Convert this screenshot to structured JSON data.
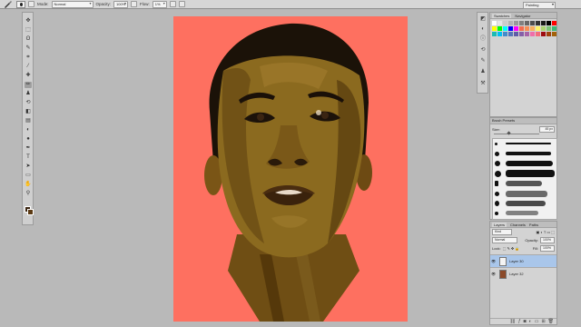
{
  "options_bar": {
    "mode_label": "Mode:",
    "mode_value": "Normal",
    "opacity_label": "Opacity:",
    "opacity_value": "100%",
    "flow_label": "Flow:",
    "flow_value": "1%"
  },
  "workspace": "Painting",
  "toolbar": {
    "tools": [
      {
        "name": "move-icon",
        "glyph": "✥"
      },
      {
        "name": "marquee-icon",
        "glyph": "⬚"
      },
      {
        "name": "lasso-icon",
        "glyph": "ʘ"
      },
      {
        "name": "quick-select-icon",
        "glyph": "✎"
      },
      {
        "name": "crop-icon",
        "glyph": "⌗"
      },
      {
        "name": "eyedropper-icon",
        "glyph": "⁄"
      },
      {
        "name": "healing-icon",
        "glyph": "✚"
      },
      {
        "name": "brush-icon",
        "glyph": "✏"
      },
      {
        "name": "stamp-icon",
        "glyph": "♟"
      },
      {
        "name": "history-brush-icon",
        "glyph": "⟲"
      },
      {
        "name": "eraser-icon",
        "glyph": "◧"
      },
      {
        "name": "gradient-icon",
        "glyph": "▤"
      },
      {
        "name": "blur-icon",
        "glyph": "◐"
      },
      {
        "name": "dodge-icon",
        "glyph": "●"
      },
      {
        "name": "pen-icon",
        "glyph": "✒"
      },
      {
        "name": "type-icon",
        "glyph": "T"
      },
      {
        "name": "path-select-icon",
        "glyph": "➤"
      },
      {
        "name": "shape-icon",
        "glyph": "▭"
      },
      {
        "name": "hand-icon",
        "glyph": "✋"
      },
      {
        "name": "zoom-icon",
        "glyph": "⚲"
      }
    ]
  },
  "swatches": {
    "tabs": [
      "Swatches",
      "Navigator"
    ],
    "colors": [
      "#ffffff",
      "#e6e6e6",
      "#cccccc",
      "#b3b3b3",
      "#999999",
      "#808080",
      "#666666",
      "#4d4d4d",
      "#333333",
      "#1a1a1a",
      "#000000",
      "#ff0000",
      "#ffff00",
      "#00ff00",
      "#00ffff",
      "#0000ff",
      "#ff00ff",
      "#f26c4f",
      "#f68e55",
      "#fbaf5c",
      "#fff467",
      "#acd372",
      "#7cc576",
      "#3bb878",
      "#1abbb4",
      "#00bff3",
      "#438ccb",
      "#5574b9",
      "#605ca8",
      "#855fa8",
      "#a763a8",
      "#f06eaa",
      "#f26d7d",
      "#9e0b0f",
      "#a0410d",
      "#a3620a"
    ]
  },
  "brush_presets": {
    "title": "Brush Presets",
    "size_label": "Size:",
    "size_value": "45 px"
  },
  "layers": {
    "tabs": [
      "Layers",
      "Channels",
      "Paths"
    ],
    "kind_label": "Kind",
    "blend_mode": "Normal",
    "opacity_label": "Opacity:",
    "opacity_value": "100%",
    "lock_label": "Lock:",
    "fill_label": "Fill:",
    "fill_value": "100%",
    "items": [
      {
        "name": "Layer 30"
      },
      {
        "name": "Layer 32"
      }
    ]
  }
}
